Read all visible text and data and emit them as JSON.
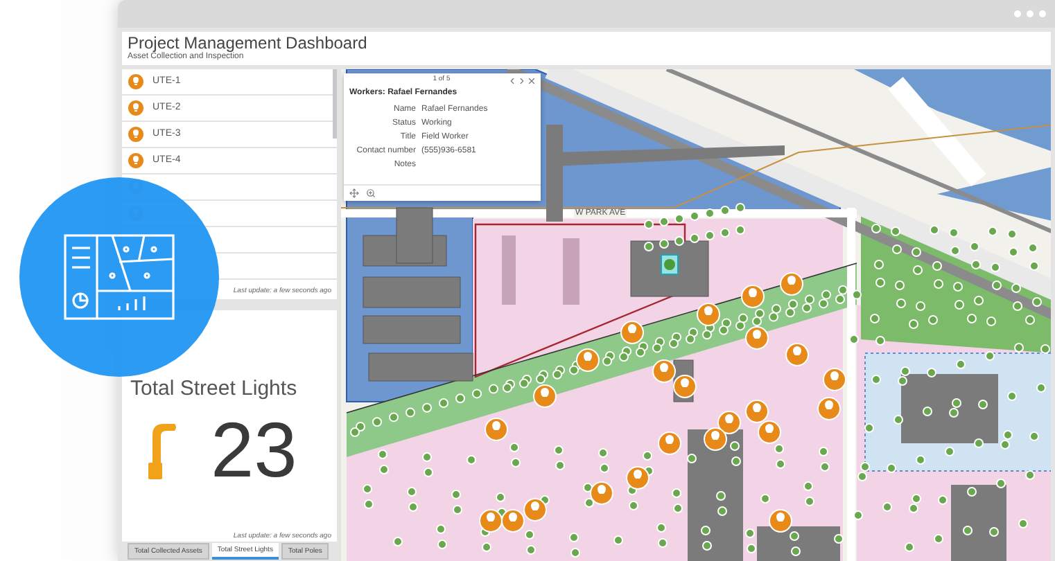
{
  "header": {
    "title": "Project Management Dashboard",
    "subtitle": "Asset Collection and Inspection"
  },
  "list": {
    "items": [
      {
        "label": "UTE-1"
      },
      {
        "label": "UTE-2"
      },
      {
        "label": "UTE-3"
      },
      {
        "label": "UTE-4"
      }
    ],
    "last_update": "Last update: a few seconds ago"
  },
  "indicator": {
    "title": "Total Street Lights",
    "value": "23",
    "last_update": "Last update: a few seconds ago"
  },
  "tabs": [
    {
      "label": "Total Collected Assets",
      "selected": false
    },
    {
      "label": "Total Street Lights",
      "selected": true
    },
    {
      "label": "Total Poles",
      "selected": false
    }
  ],
  "popup": {
    "pager": "1 of 5",
    "title": "Workers: Rafael Fernandes",
    "fields": [
      {
        "label": "Name",
        "value": "Rafael Fernandes"
      },
      {
        "label": "Status",
        "value": "Working"
      },
      {
        "label": "Title",
        "value": "Field Worker"
      },
      {
        "label": "Contact number",
        "value": "(555)936-6581"
      },
      {
        "label": "Notes"
      }
    ]
  },
  "map": {
    "labels": [
      "W PARK AVE"
    ]
  }
}
